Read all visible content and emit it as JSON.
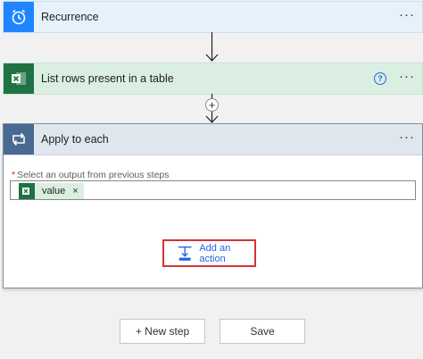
{
  "steps": {
    "recurrence": {
      "title": "Recurrence",
      "more": "···",
      "icon": "clock-icon",
      "color": "#1f85ff"
    },
    "list_rows": {
      "title": "List rows present in a table",
      "more": "···",
      "help": "?",
      "icon": "excel-icon",
      "color": "#1f7244"
    },
    "apply_to_each": {
      "title": "Apply to each",
      "more": "···",
      "icon": "loop-icon",
      "color": "#486991",
      "required_mark": "*",
      "field_label": "Select an output from previous steps",
      "token": {
        "label": "value",
        "remove": "×",
        "icon": "excel-icon"
      },
      "add_action_label": "Add an action"
    }
  },
  "connector": {
    "insert_symbol": "+"
  },
  "footer": {
    "new_step_label": "+ New step",
    "save_label": "Save"
  },
  "colors": {
    "highlight": "#d13438",
    "link": "#2266e3"
  }
}
